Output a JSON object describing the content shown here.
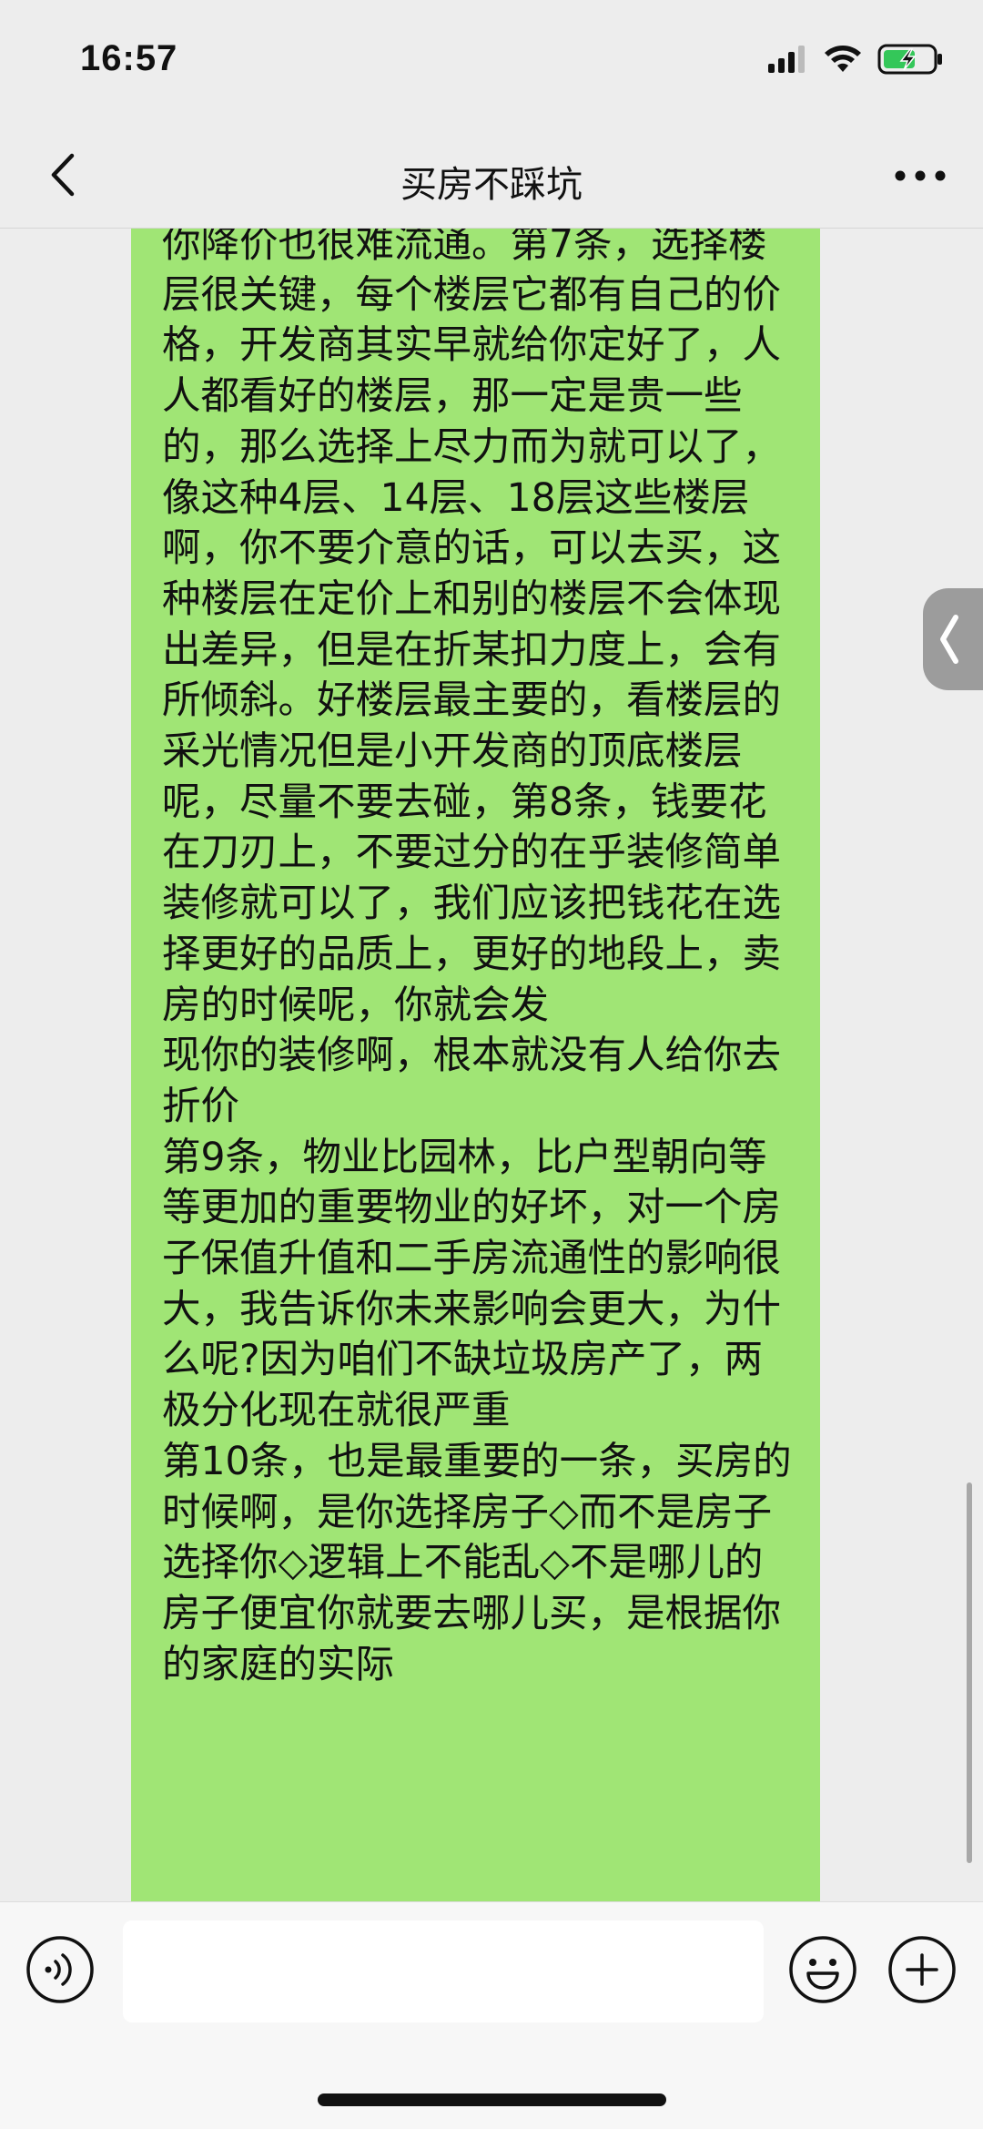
{
  "status_bar": {
    "time": "16:57"
  },
  "header": {
    "title": "买房不踩坑",
    "back_icon": "chevron-left-icon",
    "more_icon": "more-dots-icon"
  },
  "chat": {
    "bubble_color": "#a0e575",
    "message_text": "你降价也很难流通。第7条，选择楼层很关键，每个楼层它都有自己的价格，开发商其实早就给你定好了，人人都看好的楼层，那一定是贵一些的，那么选择上尽力而为就可以了，像这种4层、14层、18层这些楼层啊，你不要介意的话，可以去买，这种楼层在定价上和别的楼层不会体现出差异，但是在折某扣力度上，会有所倾斜。好楼层最主要的，看楼层的采光情况但是小开发商的顶底楼层呢，尽量不要去碰，第8条，钱要花在刀刃上，不要过分的在乎装修简单装修就可以了，我们应该把钱花在选择更好的品质上，更好的地段上，卖房的时候呢，你就会发\n现你的装修啊，根本就没有人给你去折价\n第9条，物业比园林，比户型朝向等等更加的重要物业的好坏，对一个房子保值升值和二手房流通性的影响很大，我告诉你未来影响会更大，为什么呢?因为咱们不缺垃圾房产了，两极分化现在就很严重\n第10条，也是最重要的一条，买房的时候啊，是你选择房子◇而不是房子选择你◇逻辑上不能乱◇不是哪儿的房子便宜你就要去哪儿买，是根据你的家庭的实际"
  },
  "input_bar": {
    "voice_icon": "voice-icon",
    "emoji_icon": "emoji-icon",
    "plus_icon": "plus-icon",
    "input_value": ""
  }
}
